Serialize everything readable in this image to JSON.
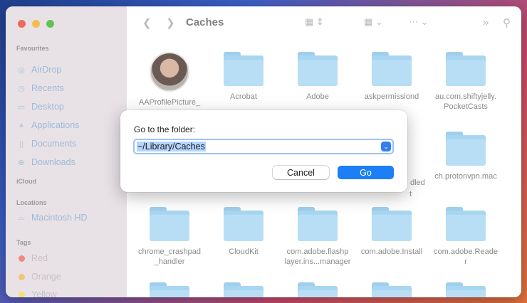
{
  "sidebar": {
    "favourites_header": "Favourites",
    "favourites": [
      {
        "label": "AirDrop",
        "icon": "airdrop-icon",
        "glyph": "◎"
      },
      {
        "label": "Recents",
        "icon": "clock-icon",
        "glyph": "◷"
      },
      {
        "label": "Desktop",
        "icon": "desktop-icon",
        "glyph": "▭"
      },
      {
        "label": "Applications",
        "icon": "applications-icon",
        "glyph": "⩓"
      },
      {
        "label": "Documents",
        "icon": "document-icon",
        "glyph": "▯"
      },
      {
        "label": "Downloads",
        "icon": "download-icon",
        "glyph": "⊕"
      }
    ],
    "icloud_header": "iCloud",
    "locations_header": "Locations",
    "locations": [
      {
        "label": "Macintosh HD",
        "icon": "disk-icon",
        "glyph": "⌓"
      }
    ],
    "tags_header": "Tags",
    "tags": [
      {
        "label": "Red",
        "color": "#f08a84"
      },
      {
        "label": "Orange",
        "color": "#f5c27d"
      },
      {
        "label": "Yellow",
        "color": "#f5dd7a"
      }
    ]
  },
  "toolbar": {
    "back_icon": "chevron-left-icon",
    "forward_icon": "chevron-right-icon",
    "title": "Caches",
    "view_icon": "grid-view-icon",
    "group_icon": "group-icon",
    "action_icon": "more-icon",
    "overflow_icon": "double-chevron-icon",
    "search_icon": "search-icon"
  },
  "files": [
    {
      "name": "AAProfilePicture_",
      "kind": "avatar"
    },
    {
      "name": "Acrobat",
      "kind": "folder"
    },
    {
      "name": "Adobe",
      "kind": "folder"
    },
    {
      "name": "askpermissiond",
      "kind": "folder"
    },
    {
      "name": "au.com.shiftyjelly.\nPocketCasts",
      "kind": "folder"
    },
    {
      "name": "ch.protonvpn.mac",
      "kind": "folder"
    },
    {
      "name": "chrome_crashpad\n_handler",
      "kind": "folder"
    },
    {
      "name": "CloudKit",
      "kind": "folder"
    },
    {
      "name": "com.adobe.flashp\nlayer.ins...manager",
      "kind": "folder"
    },
    {
      "name": "com.adobe.Install",
      "kind": "folder"
    },
    {
      "name": "com.adobe.Reade\nr",
      "kind": "folder"
    }
  ],
  "partial_labels": {
    "dled": "dled",
    "t": "t"
  },
  "dialog": {
    "label": "Go to the folder:",
    "path_value": "~/Library/Caches",
    "cancel_label": "Cancel",
    "go_label": "Go",
    "accent": "#1d7ff5"
  }
}
